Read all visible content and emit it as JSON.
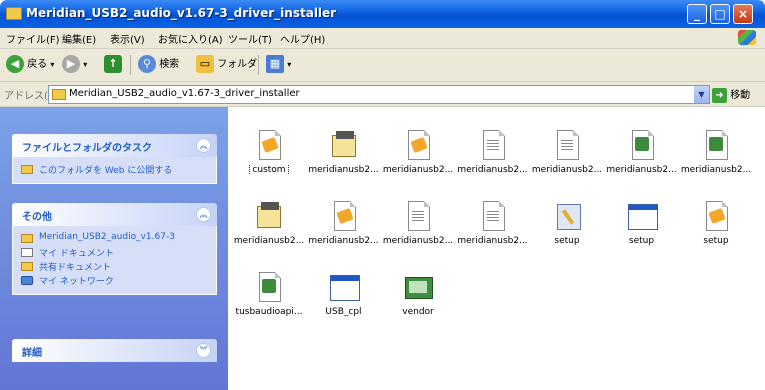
{
  "window": {
    "title": "Meridian_USB2_audio_v1.67-3_driver_installer",
    "controls": [
      "minimize",
      "maximize",
      "close"
    ]
  },
  "menu": [
    "ファイル(F)",
    "編集(E)",
    "表示(V)",
    "お気に入り(A)",
    "ツール(T)",
    "ヘルプ(H)"
  ],
  "toolbar": {
    "back_label": "戻る",
    "search_label": "検索",
    "folders_label": "フォルダ"
  },
  "address": {
    "label": "アドレス(D)",
    "path": "Meridian_USB2_audio_v1.67-3_driver_installer",
    "go_label": "移動"
  },
  "taskpane": {
    "folder_tasks": {
      "title": "ファイルとフォルダのタスク",
      "items": [
        "このフォルダを Web に公開する"
      ]
    },
    "other_places": {
      "title": "その他",
      "items": [
        "Meridian_USB2_audio_v1.67-3",
        "マイ ドキュメント",
        "共有ドキュメント",
        "マイ ネットワーク"
      ]
    },
    "details": {
      "title": "詳細"
    }
  },
  "files": [
    {
      "label": "custom",
      "icon": "settings-file-icon",
      "selected": true
    },
    {
      "label": "meridianusb2...",
      "icon": "setup-info-icon"
    },
    {
      "label": "meridianusb2...",
      "icon": "settings-file-icon"
    },
    {
      "label": "meridianusb2...",
      "icon": "text-document-icon"
    },
    {
      "label": "meridianusb2...",
      "icon": "text-document-icon"
    },
    {
      "label": "meridianusb2...",
      "icon": "dll-icon"
    },
    {
      "label": "meridianusb2...",
      "icon": "dll-icon"
    },
    {
      "label": "meridianusb2...",
      "icon": "setup-info-icon"
    },
    {
      "label": "meridianusb2...",
      "icon": "settings-file-icon"
    },
    {
      "label": "meridianusb2...",
      "icon": "text-document-icon"
    },
    {
      "label": "meridianusb2...",
      "icon": "text-document-icon"
    },
    {
      "label": "setup",
      "icon": "setup-icon"
    },
    {
      "label": "setup",
      "icon": "application-window-icon"
    },
    {
      "label": "setup",
      "icon": "settings-file-icon"
    },
    {
      "label": "tusbaudioapi...",
      "icon": "dll-icon"
    },
    {
      "label": "USB_cpl",
      "icon": "application-window-icon"
    },
    {
      "label": "vendor",
      "icon": "image-file-icon"
    }
  ]
}
